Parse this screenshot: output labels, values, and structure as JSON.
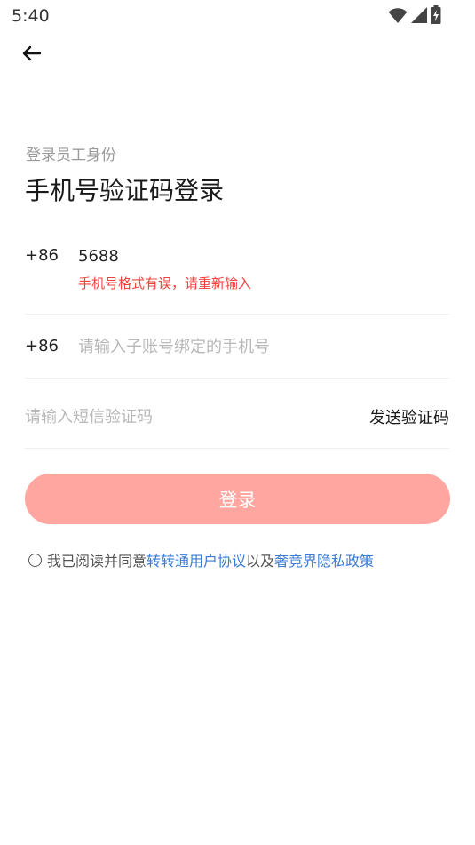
{
  "status_bar": {
    "time": "5:40",
    "icons": [
      "wifi-icon",
      "cell-signal-icon",
      "battery-charging-icon"
    ]
  },
  "header": {
    "back_icon": "arrow-left-icon"
  },
  "login": {
    "subtitle": "登录员工身份",
    "title": "手机号验证码登录",
    "phone1": {
      "country_code": "+86",
      "value": "5688",
      "error": "手机号格式有误，请重新输入"
    },
    "phone2": {
      "country_code": "+86",
      "placeholder": "请输入子账号绑定的手机号"
    },
    "code": {
      "placeholder": "请输入短信验证码",
      "send_label": "发送验证码"
    },
    "submit_label": "登录"
  },
  "agreement": {
    "prefix": "我已阅读并同意",
    "link1": "转转通用户协议",
    "middle": "以及",
    "link2": "奢竟界隐私政策"
  },
  "colors": {
    "primary": "#ffa6a0",
    "error": "#f0403c",
    "link": "#3a7bd5"
  }
}
